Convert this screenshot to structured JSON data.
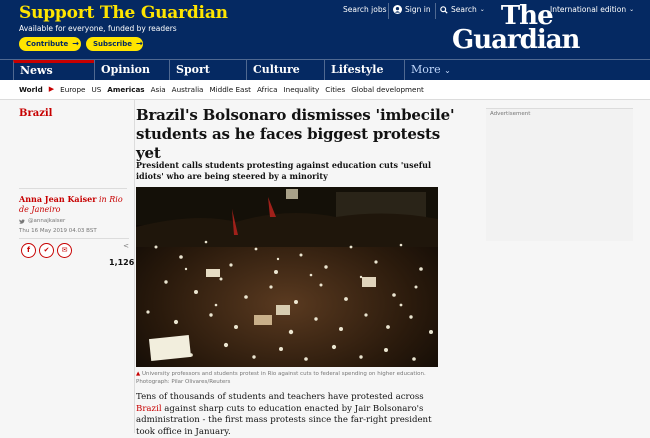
{
  "header": {
    "support_title": "Support The Guardian",
    "support_sub": "Available for everyone, funded by readers",
    "contribute_label": "Contribute",
    "subscribe_label": "Subscribe",
    "arrow": "→",
    "search_jobs": "Search jobs",
    "sign_in": "Sign in",
    "search": "Search",
    "edition": "International edition",
    "logo_line1": "The",
    "logo_line2": "Guardian"
  },
  "nav": {
    "items": [
      "News",
      "Opinion",
      "Sport",
      "Culture",
      "Lifestyle",
      "More"
    ],
    "active": "News"
  },
  "subnav": {
    "items": [
      "World",
      "Europe",
      "US",
      "Americas",
      "Asia",
      "Australia",
      "Middle East",
      "Africa",
      "Inequality",
      "Cities",
      "Global development"
    ]
  },
  "article": {
    "section": "Brazil",
    "headline": "Brazil's Bolsonaro dismisses 'imbecile' students as he faces biggest protests yet",
    "standfirst": "President calls students protesting against education cuts 'useful idiots' who are being steered by a minority",
    "author": "Anna Jean Kaiser",
    "author_location": "in Rio de Janeiro",
    "twitter": "@annajkaiser",
    "date": "Thu 16 May 2019 04.03 BST",
    "share_count": "1,126",
    "caption": "University professors and students protest in Rio against cuts to federal spending on higher education. Photograph: Pilar Olivares/Reuters",
    "body_before_link": "Tens of thousands of students and teachers have protested across ",
    "body_link": "Brazil",
    "body_after_link": " against sharp cuts to education enacted by Jair Bolsonaro's administration - the first mass protests since the far-right president took office in January."
  },
  "ad": {
    "label": "Advertisement"
  },
  "colors": {
    "brand": "#052962",
    "accent": "#c70000",
    "support_yellow": "#ffe500"
  }
}
